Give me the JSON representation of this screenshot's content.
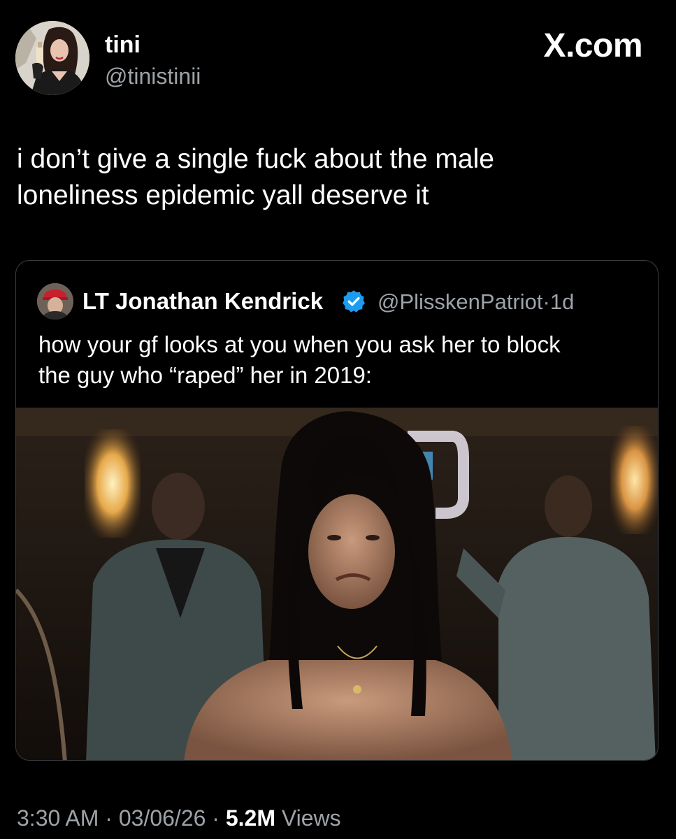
{
  "author": {
    "display_name": "tini",
    "handle": "@tinistinii",
    "avatar_icon": "avatar-illustration"
  },
  "brand": {
    "label": "X.com"
  },
  "tweet": {
    "text_line1": "i don’t give a single fuck about the male",
    "text_line2": "loneliness epidemic yall deserve it"
  },
  "quoted_tweet": {
    "display_name": "LT Jonathan Kendrick",
    "verified_icon": "verified-badge-icon",
    "handle": "@PlisskenPatriot",
    "separator": "·",
    "age": "1d",
    "text_line1": "how your gf looks at you when you ask her to block",
    "text_line2": "the guy who “raped” her in 2019:",
    "media_type": "image"
  },
  "meta": {
    "time": "3:30 AM",
    "separator": "·",
    "date": "03/06/26",
    "views_count": "5.2M",
    "views_label": "Views"
  },
  "colors": {
    "background": "#000000",
    "text_primary": "#ffffff",
    "text_secondary": "#9ea3a8",
    "border": "#3a3d40",
    "verified_blue": "#1d9bf0"
  }
}
